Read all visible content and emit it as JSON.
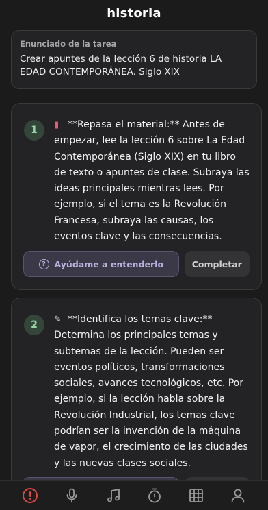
{
  "header": {
    "title": "historia"
  },
  "task": {
    "label": "Enunciado de la tarea",
    "text": "Crear apuntes de la lección 6 de historia LA EDAD CONTEMPORÁNEA. Siglo XIX"
  },
  "steps": [
    {
      "number": "1",
      "icon": "backpack-icon",
      "text": "**Repasa el material:** Antes de empezar, lee la lección 6 sobre La Edad Contemporánea (Siglo XIX) en tu libro de texto o apuntes de clase. Subraya las ideas principales mientras lees. Por ejemplo, si el tema es la Revolución Francesa, subraya las causas, los eventos clave y las consecuencias.",
      "help_label": "Ayúdame a entenderlo",
      "complete_label": "Completar"
    },
    {
      "number": "2",
      "icon": "memo-icon",
      "text": "**Identifica los temas clave:** Determina los principales temas y subtemas de la lección. Pueden ser eventos políticos, transformaciones sociales, avances tecnológicos, etc. Por ejemplo, si la lección habla sobre la Revolución Industrial, los temas clave podrían ser la invención de la máquina de vapor, el crecimiento de las ciudades y las nuevas clases sociales."
    }
  ],
  "nav": {
    "items": [
      "alert-icon",
      "microphone-icon",
      "music-note-icon",
      "timer-icon",
      "grid-icon",
      "user-icon"
    ],
    "active_color": "#e04545",
    "inactive_color": "#9a9a9c"
  },
  "colors": {
    "accent": "#b9b2df",
    "step_number": "#9ad3a7"
  }
}
